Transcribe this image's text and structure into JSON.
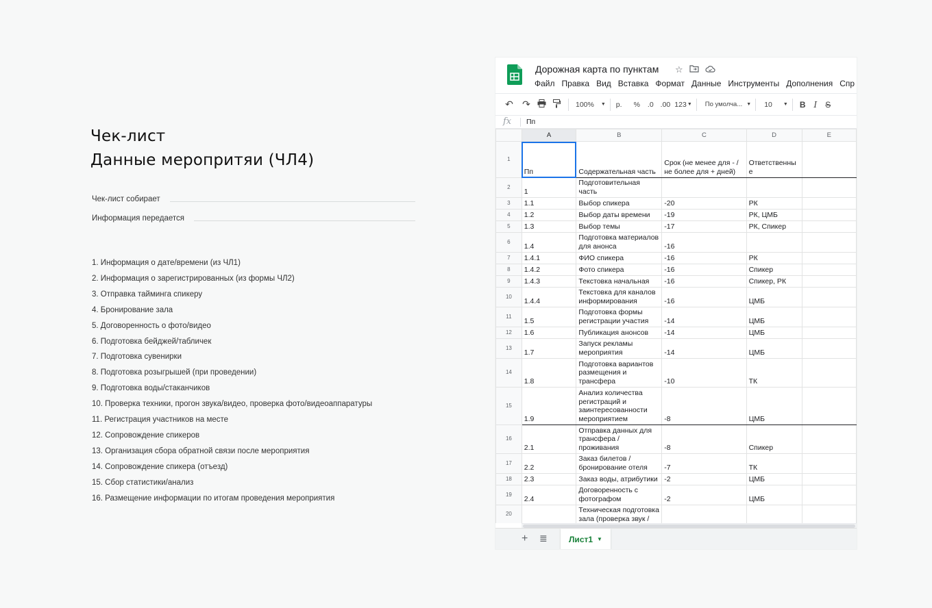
{
  "checklist": {
    "title_line1": "Чек-лист",
    "title_line2": "Данные меропритяи (ЧЛ4)",
    "fields": [
      {
        "label": "Чек-лист собирает"
      },
      {
        "label": "Информация передается"
      }
    ],
    "items": [
      "1. Информация о дате/времени (из ЧЛ1)",
      "2. Информация о зарегистрированных (из формы ЧЛ2)",
      "3. Отправка тайминга спикеру",
      "4. Бронирование зала",
      "5. Договоренность о фото/видео",
      "6. Подготовка бейджей/табличек",
      "7. Подготовка сувенирки",
      "8. Подготовка розыгрышей (при проведении)",
      "9. Подготовка воды/стаканчиков",
      "10. Проверка техники, прогон звука/видео, проверка фото/видеоаппаратуры",
      "11. Регистрация участников на месте",
      "12. Сопровождение спикеров",
      "13. Организация сбора обратной связи после мероприятия",
      "14. Сопровождение спикера (отъезд)",
      "15. Сбор статистики/анализ",
      "16. Размещение информации по итогам проведения мероприятия"
    ]
  },
  "sheet": {
    "doc_title": "Дорожная карта по пунктам",
    "title_icons": [
      "star-icon",
      "move-to-folder-icon",
      "cloud-status-icon"
    ],
    "menu": [
      "Файл",
      "Правка",
      "Вид",
      "Вставка",
      "Формат",
      "Данные",
      "Инструменты",
      "Дополнения",
      "Спр"
    ],
    "toolbar": {
      "zoom": "100%",
      "currency": "р.",
      "percent": "%",
      "dec_less": ".0",
      "dec_more": ".00",
      "more_formats": "123",
      "font": "По умолча...",
      "font_size": "10",
      "bold": "B",
      "italic": "I",
      "strike": "S"
    },
    "formula_label": "fx",
    "formula_value": "Пп",
    "columns": [
      "A",
      "B",
      "C",
      "D",
      "E"
    ],
    "rows": [
      {
        "n": "1",
        "a": "Пп",
        "b": "Содержательная часть",
        "c": "Срок (не менее для - / не более для + дней)",
        "d": "Ответственны е"
      },
      {
        "n": "2",
        "a": "1",
        "b": "Подготовительная часть",
        "c": "",
        "d": ""
      },
      {
        "n": "3",
        "a": "1.1",
        "b": "Выбор спикера",
        "c": "-20",
        "d": "РК"
      },
      {
        "n": "4",
        "a": "1.2",
        "b": "Выбор даты времени",
        "c": "-19",
        "d": "РК, ЦМБ"
      },
      {
        "n": "5",
        "a": "1.3",
        "b": "Выбор темы",
        "c": "-17",
        "d": "РК, Спикер"
      },
      {
        "n": "6",
        "a": "1.4",
        "b": "Подготовка материалов для анонса",
        "c": "-16",
        "d": ""
      },
      {
        "n": "7",
        "a": "1.4.1",
        "b": "ФИО спикера",
        "c": "-16",
        "d": "РК"
      },
      {
        "n": "8",
        "a": "1.4.2",
        "b": "Фото спикера",
        "c": "-16",
        "d": "Спикер"
      },
      {
        "n": "9",
        "a": "1.4.3",
        "b": "Текстовка начальная",
        "c": "-16",
        "d": "Спикер, РК"
      },
      {
        "n": "10",
        "a": "1.4.4",
        "b": "Текстовка для каналов информирования",
        "c": "-16",
        "d": "ЦМБ"
      },
      {
        "n": "11",
        "a": "1.5",
        "b": "Подготовка формы регистрации участия",
        "c": "-14",
        "d": "ЦМБ"
      },
      {
        "n": "12",
        "a": "1.6",
        "b": "Публикация анонсов",
        "c": "-14",
        "d": "ЦМБ"
      },
      {
        "n": "13",
        "a": "1.7",
        "b": "Запуск рекламы мероприятия",
        "c": "-14",
        "d": "ЦМБ"
      },
      {
        "n": "14",
        "a": "1.8",
        "b": "Подготовка вариантов размещения и трансфера",
        "c": "-10",
        "d": "ТК"
      },
      {
        "n": "15",
        "a": "1.9",
        "b": "Анализ количества регистраций и заинтересованности мероприятием",
        "c": "-8",
        "d": "ЦМБ"
      },
      {
        "n": "16",
        "a": "2.1",
        "b": "Отправка данных для трансфера / проживания",
        "c": "-8",
        "d": "Спикер"
      },
      {
        "n": "17",
        "a": "2.2",
        "b": "Заказ билетов / бронирование отеля",
        "c": "-7",
        "d": "ТК"
      },
      {
        "n": "18",
        "a": "2.3",
        "b": "Заказ воды, атрибутики",
        "c": "-2",
        "d": "ЦМБ"
      },
      {
        "n": "19",
        "a": "2.4",
        "b": "Договоренность с фотографом",
        "c": "-2",
        "d": "ЦМБ"
      },
      {
        "n": "20",
        "a": "",
        "b": "Техническая подготовка зала (проверка звук /",
        "c": "",
        "d": ""
      }
    ],
    "sheet_tab": "Лист1",
    "colors": {
      "accent": "#1a73e8",
      "tab_green": "#188038",
      "logo_green": "#0f9d58"
    }
  }
}
